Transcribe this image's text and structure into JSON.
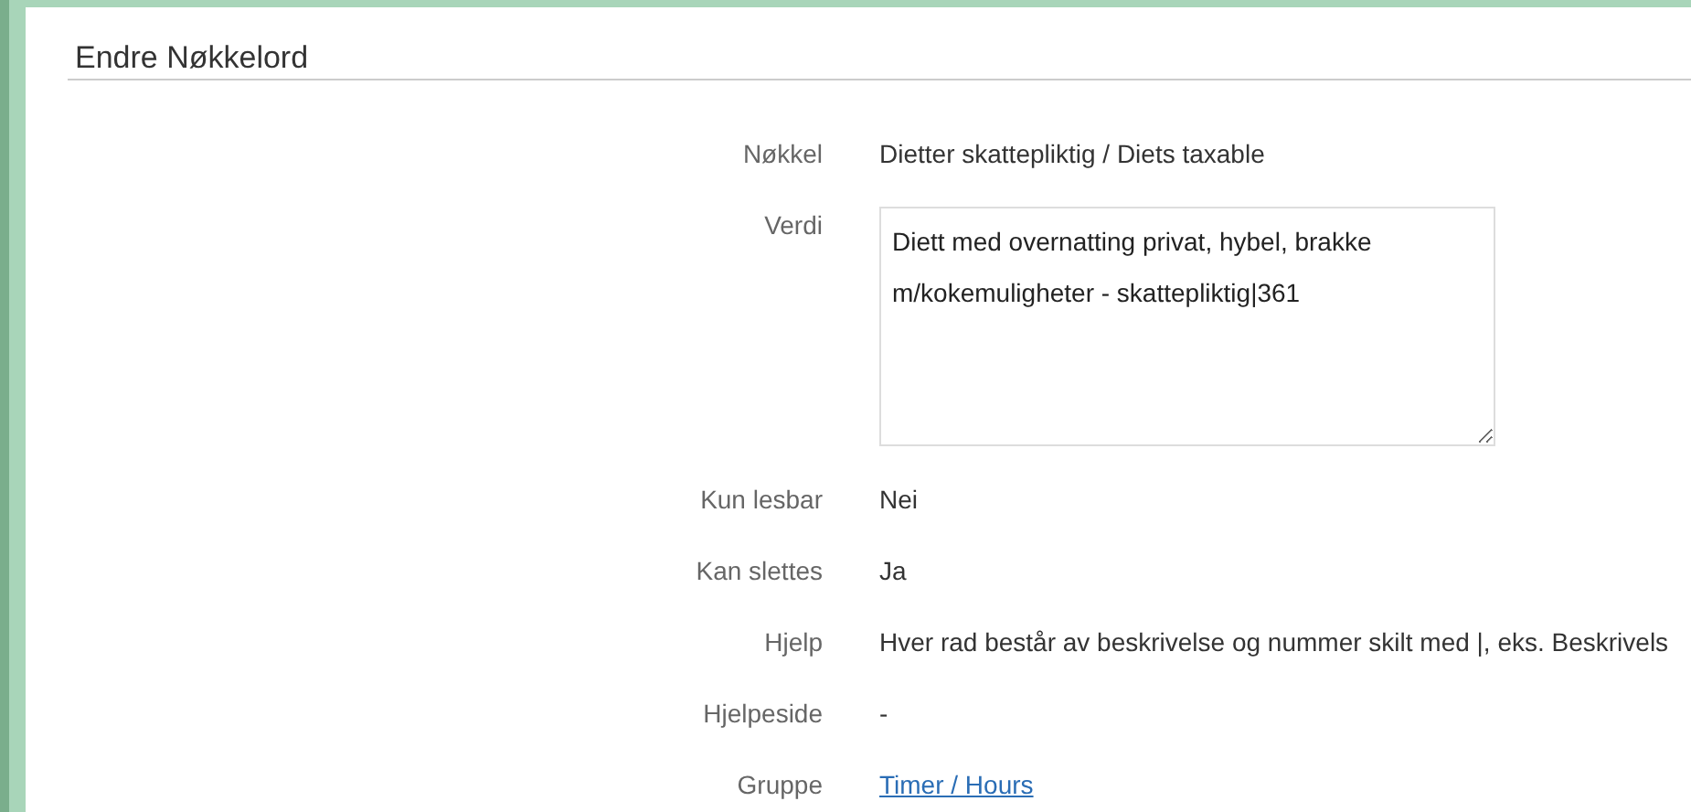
{
  "title": "Endre Nøkkelord",
  "fields": [
    {
      "label": "Nøkkel",
      "kind": "text",
      "value": "Dietter skattepliktig / Diets taxable"
    },
    {
      "label": "Verdi",
      "kind": "textarea",
      "value": "Diett med overnatting privat, hybel, brakke m/kokemuligheter - skattepliktig|361"
    },
    {
      "label": "Kun lesbar",
      "kind": "text",
      "value": "Nei"
    },
    {
      "label": "Kan slettes",
      "kind": "text",
      "value": "Ja"
    },
    {
      "label": "Hjelp",
      "kind": "text",
      "value": "Hver rad består av beskrivelse og nummer skilt med |, eks. Beskrivels"
    },
    {
      "label": "Hjelpeside",
      "kind": "text",
      "value": "-"
    },
    {
      "label": "Gruppe",
      "kind": "link",
      "value": "Timer / Hours"
    }
  ]
}
